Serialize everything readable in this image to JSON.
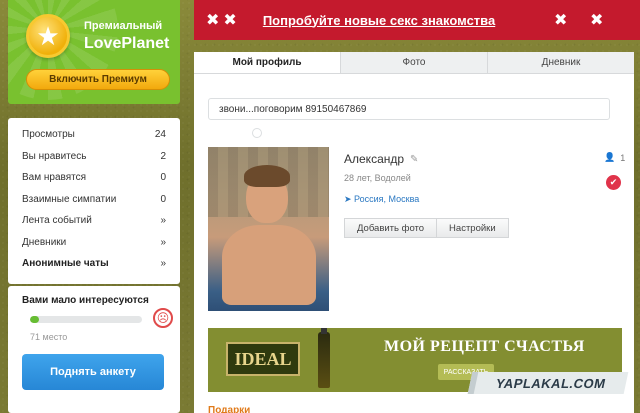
{
  "premium": {
    "title": "Премиальный",
    "brand": "LovePlanet",
    "button_label": "Включить Премиум",
    "icon": "star-icon"
  },
  "banner": {
    "text": "Попробуйте новые секс знакомства",
    "background": "#c41a2d"
  },
  "tabs": [
    {
      "label": "Мой профиль",
      "active": true
    },
    {
      "label": "Фото",
      "active": false
    },
    {
      "label": "Дневник",
      "active": false
    }
  ],
  "sidebar": {
    "items": [
      {
        "label": "Просмотры",
        "count": "24"
      },
      {
        "label": "Вы нравитесь",
        "count": "2"
      },
      {
        "label": "Вам нравятся",
        "count": "0"
      },
      {
        "label": "Взаимные симпатии",
        "count": "0"
      },
      {
        "label": "Лента событий",
        "count": "»"
      },
      {
        "label": "Дневники",
        "count": "»"
      },
      {
        "label": "Анонимные чаты",
        "count": "»"
      }
    ]
  },
  "interest": {
    "title": "Вами мало интересуются",
    "rank": "71 место",
    "button_label": "Поднять анкету",
    "level_fraction": 0.08
  },
  "profile": {
    "status_text": "звони...поговорим 89150467869",
    "name": "Александр",
    "age_sign": "28 лет, Водолей",
    "location": "Россия, Москва",
    "add_photo_label": "Добавить фото",
    "settings_label": "Настройки",
    "viewers_count": "1"
  },
  "ad": {
    "logo": "IDEAL",
    "slogan": "МОЙ РЕЦЕПТ СЧАСТЬЯ",
    "button_label": "РАССКАЗАТЬ"
  },
  "gifts_label": "Подарки",
  "watermark": "YAPLAKAL.COM"
}
